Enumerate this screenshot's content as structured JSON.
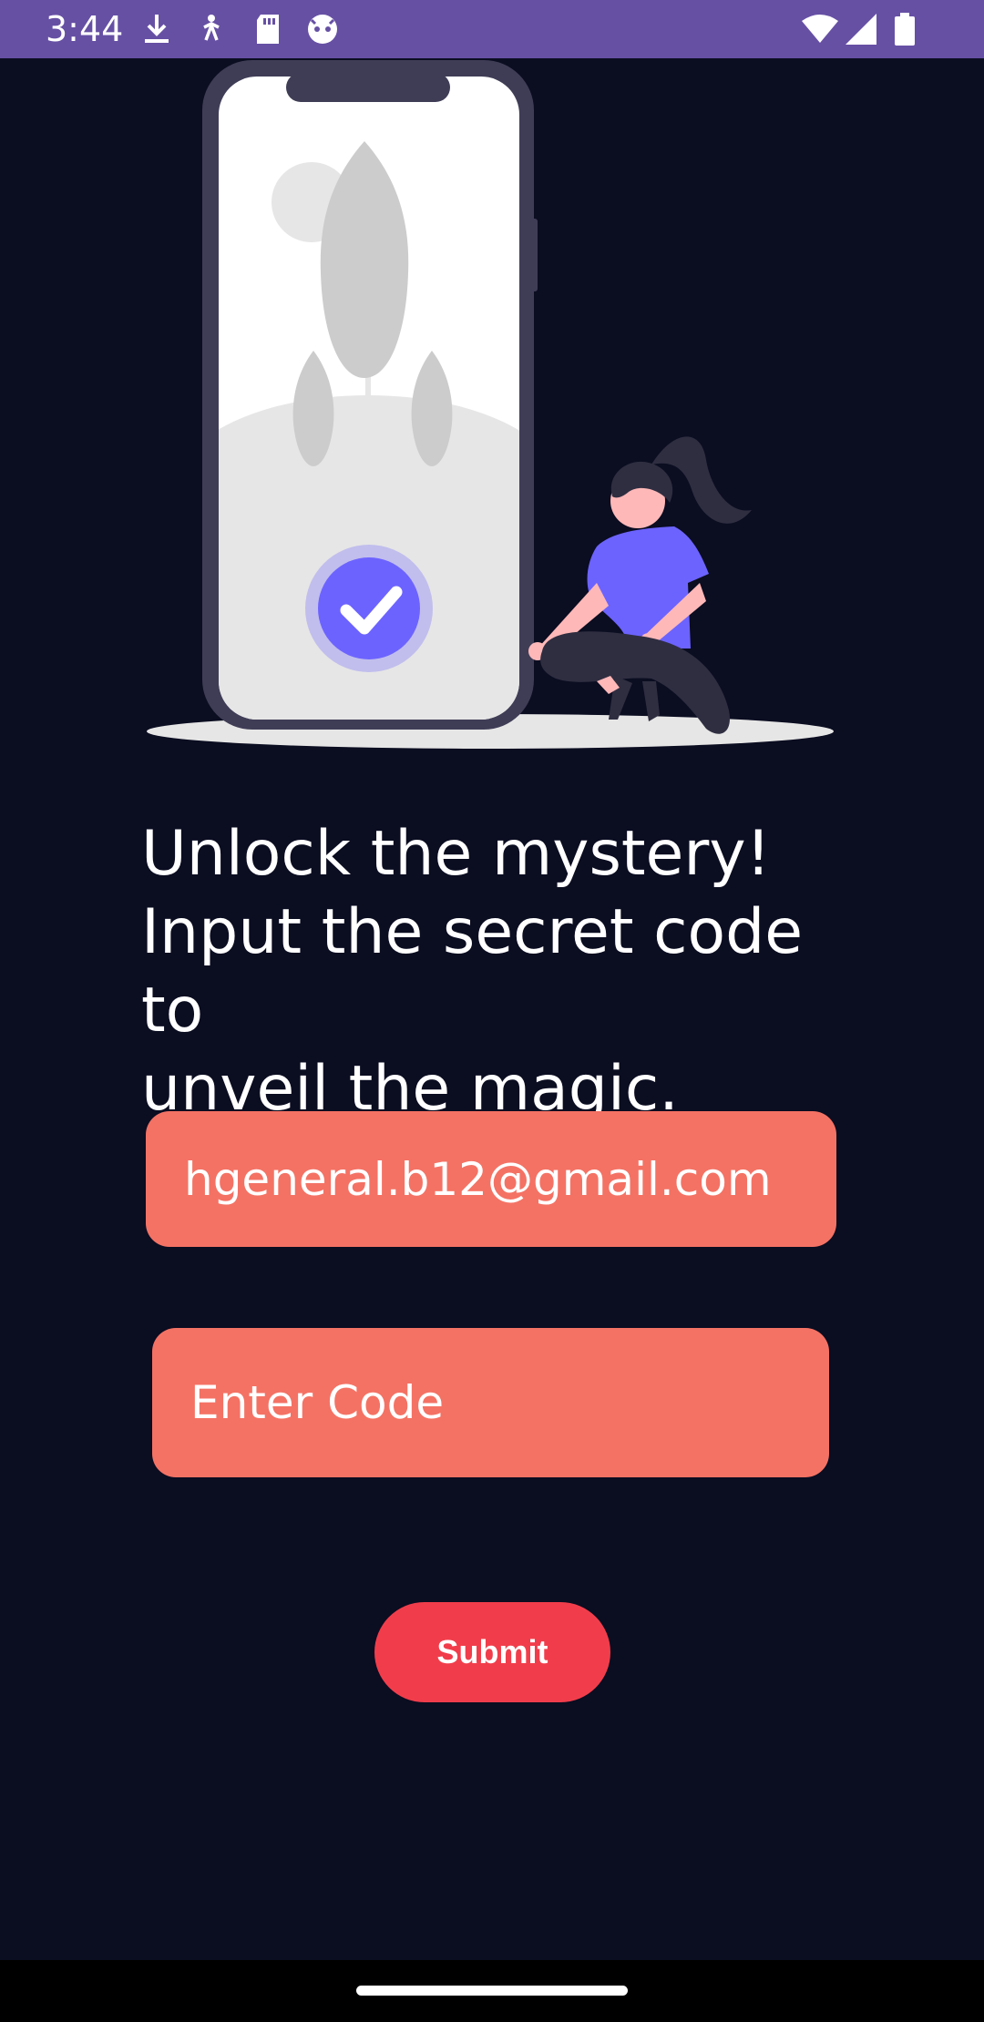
{
  "status_bar": {
    "time": "3:44",
    "left_icons": [
      "download-icon",
      "accessibility-icon",
      "sd-card-icon",
      "android-face-icon"
    ],
    "right_icons": [
      "wifi-icon",
      "cellular-signal-icon",
      "battery-icon"
    ],
    "background_color": "#6650a4"
  },
  "heading": {
    "line1": "Unlock the mystery!",
    "line2": "Input the secret code to",
    "line3": "unveil the magic."
  },
  "email_field": {
    "value": "hgeneral.b12@gmail.com"
  },
  "code_field": {
    "placeholder": "Enter Code",
    "value": ""
  },
  "submit_button": {
    "label": "Submit"
  },
  "colors": {
    "background": "#0b0d21",
    "field": "#f47264",
    "button": "#f13d4b",
    "accent": "#6c63ff"
  }
}
